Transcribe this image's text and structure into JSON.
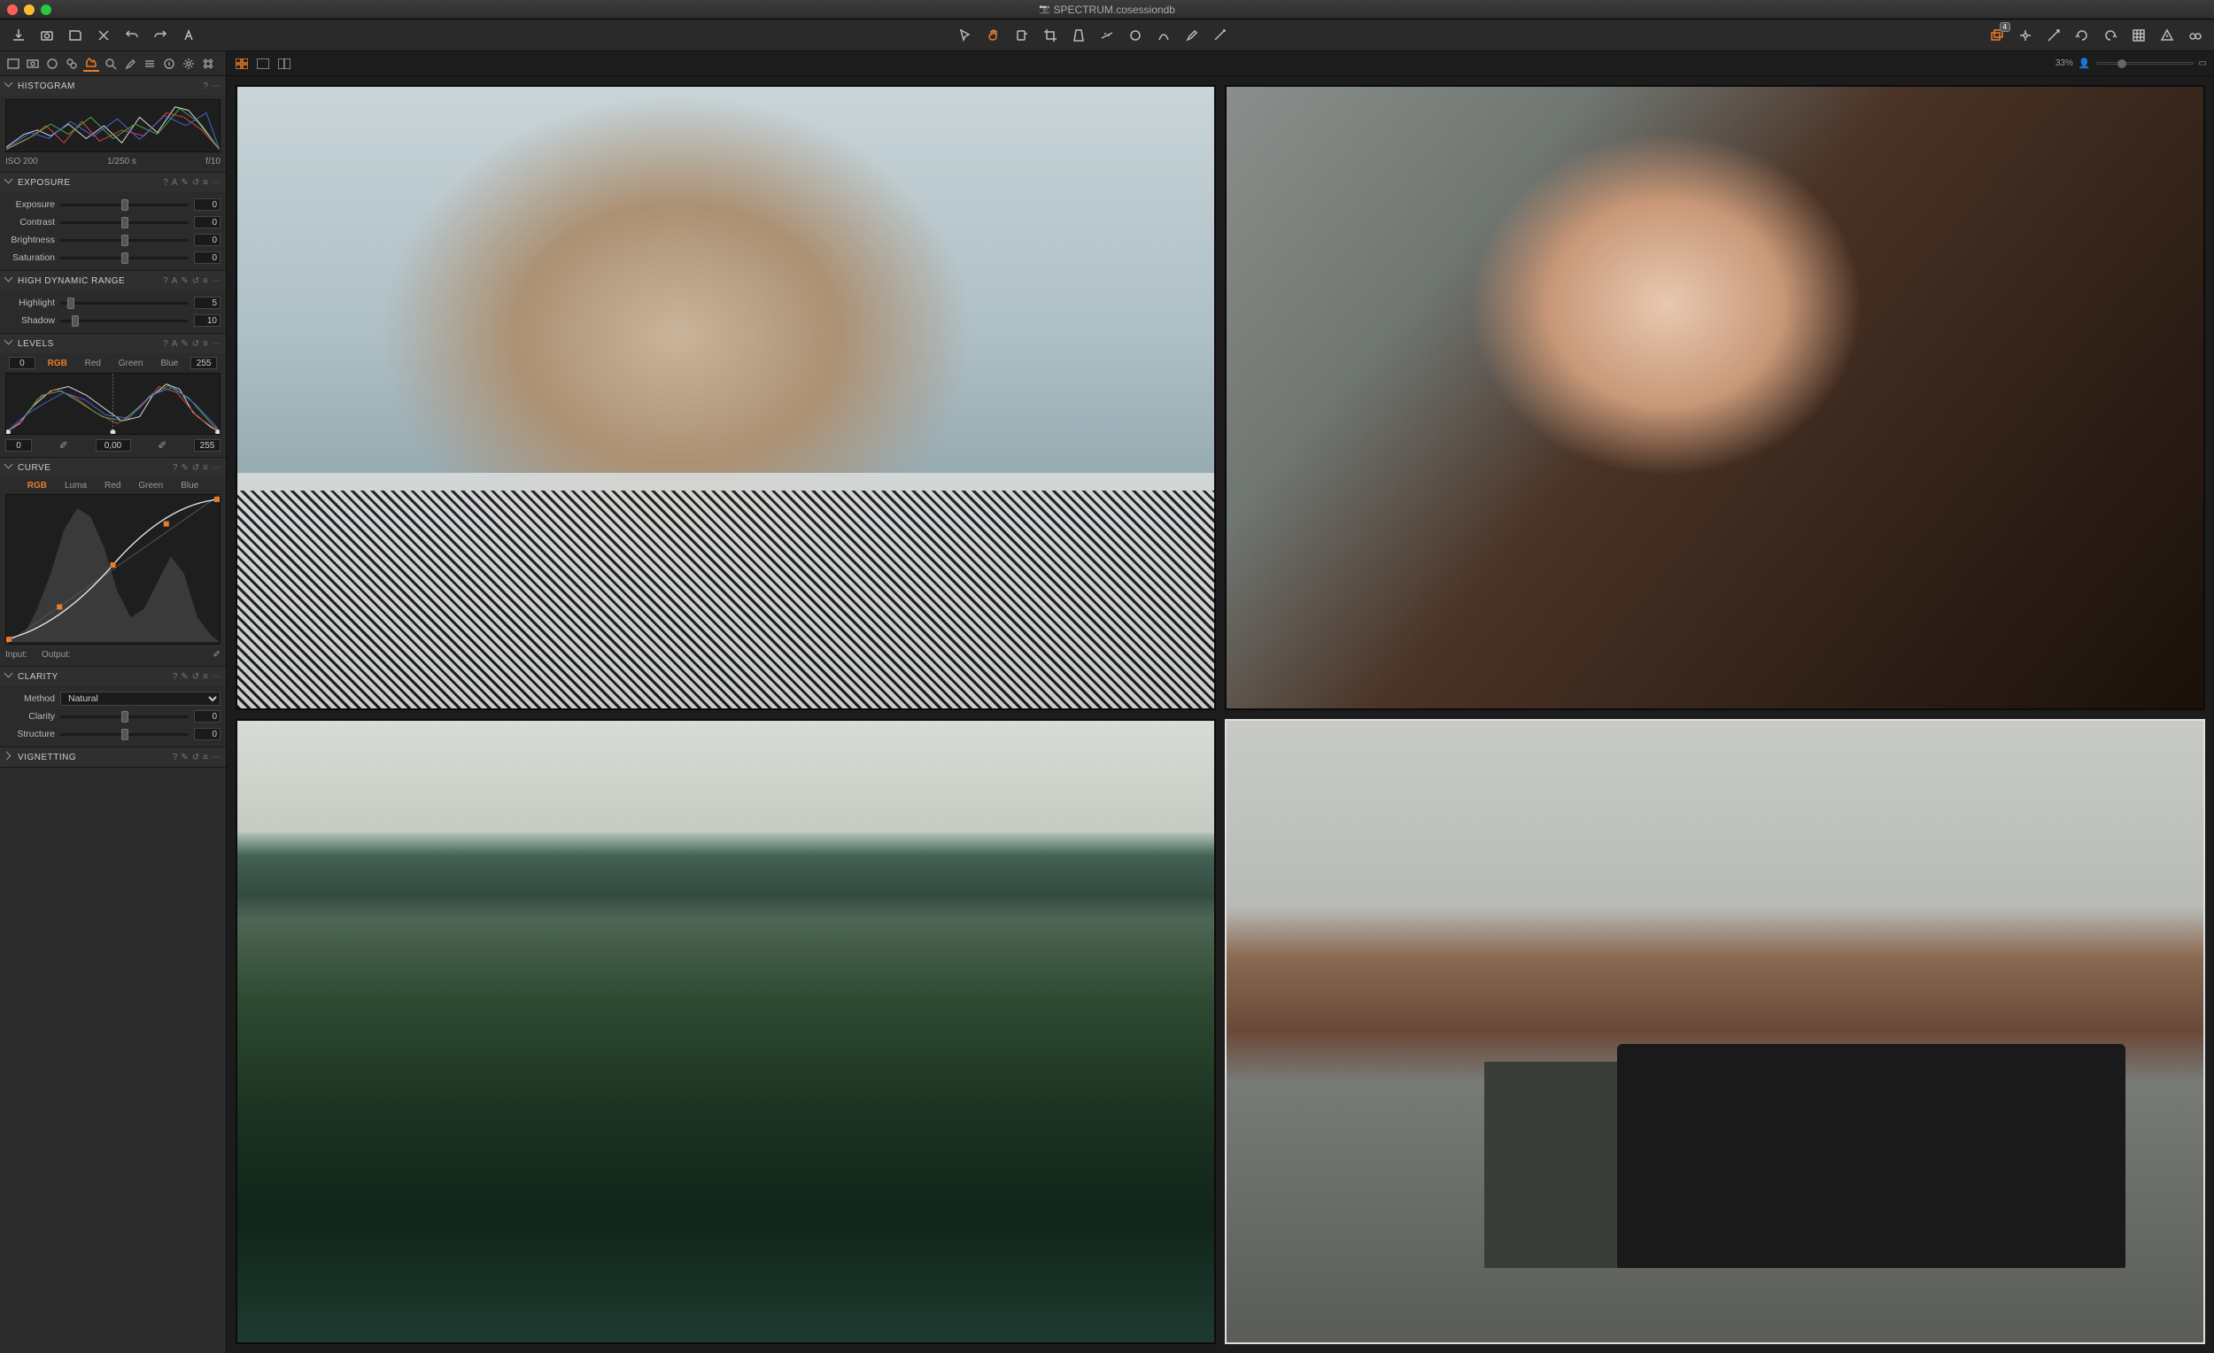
{
  "colors": {
    "accent": "#e87d2a",
    "bg_dark": "#1a1a1a",
    "panel": "#2b2b2b"
  },
  "titlebar": {
    "title": "SPECTRUM.cosessiondb"
  },
  "toolbar": {
    "left_icons": [
      "import",
      "capture",
      "export",
      "delete",
      "undo",
      "redo",
      "text"
    ],
    "center_icons": [
      "pointer",
      "hand",
      "loupe",
      "crop",
      "keystone",
      "straighten",
      "spot",
      "heal",
      "brush",
      "gradient"
    ],
    "right_icons": [
      "variant-stack",
      "focus-mask",
      "highlight-warn",
      "rotate-ccw",
      "rotate-cw",
      "grid",
      "warnings",
      "glasses"
    ],
    "variant_badge": "4"
  },
  "tool_tabs": [
    "library",
    "capture",
    "color",
    "lens",
    "exposure",
    "crop",
    "details",
    "adjust",
    "metadata",
    "settings",
    "batch"
  ],
  "content_bar": {
    "view_modes": [
      "grid",
      "single",
      "split"
    ],
    "zoom_pct": "33%"
  },
  "panels": {
    "histogram": {
      "title": "HISTOGRAM",
      "meta": {
        "iso": "ISO 200",
        "shutter": "1/250 s",
        "aperture": "f/10"
      }
    },
    "exposure": {
      "title": "EXPOSURE",
      "sliders": [
        {
          "label": "Exposure",
          "value": "0"
        },
        {
          "label": "Contrast",
          "value": "0"
        },
        {
          "label": "Brightness",
          "value": "0"
        },
        {
          "label": "Saturation",
          "value": "0"
        }
      ]
    },
    "hdr": {
      "title": "HIGH DYNAMIC RANGE",
      "sliders": [
        {
          "label": "Highlight",
          "value": "5",
          "pos": 8
        },
        {
          "label": "Shadow",
          "value": "10",
          "pos": 12
        }
      ]
    },
    "levels": {
      "title": "LEVELS",
      "low": "0",
      "high": "255",
      "channels": [
        "RGB",
        "Red",
        "Green",
        "Blue"
      ],
      "active_channel": "RGB",
      "out_low": "0",
      "out_mid": "0,00",
      "out_high": "255"
    },
    "curve": {
      "title": "CURVE",
      "channels": [
        "RGB",
        "Luma",
        "Red",
        "Green",
        "Blue"
      ],
      "active_channel": "RGB",
      "input_label": "Input:",
      "output_label": "Output:"
    },
    "clarity": {
      "title": "CLARITY",
      "method_label": "Method",
      "method_value": "Natural",
      "sliders": [
        {
          "label": "Clarity",
          "value": "0"
        },
        {
          "label": "Structure",
          "value": "0"
        }
      ]
    },
    "vignetting": {
      "title": "VIGNETTING"
    }
  },
  "thumbnails": [
    "portrait-woman-looking-down",
    "portrait-woman-in-tub",
    "mountain-lake-landscape",
    "city-street-cars"
  ],
  "selected_thumb": 4
}
